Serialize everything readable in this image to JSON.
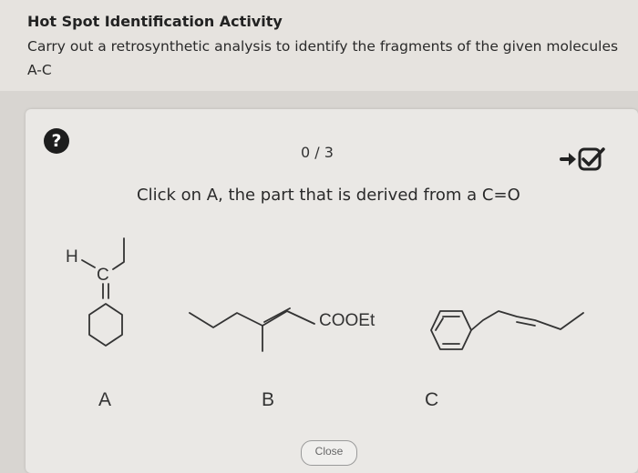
{
  "header": {
    "title": "Hot Spot Identification Activity",
    "subtitle": "Carry out a retrosynthetic analysis to identify the fragments of the given molecules A-C"
  },
  "activity": {
    "progress": "0 / 3",
    "instruction": "Click on A, the part that is derived from a C=O"
  },
  "molecules": {
    "a": {
      "label": "A",
      "atom_h": "H",
      "atom_c": "C"
    },
    "b": {
      "label": "B",
      "group": "COOEt"
    },
    "c": {
      "label": "C"
    }
  },
  "footer": {
    "close_label": "Close"
  },
  "icons": {
    "help": "help-question-icon",
    "submit": "arrow-check-submit-icon"
  }
}
